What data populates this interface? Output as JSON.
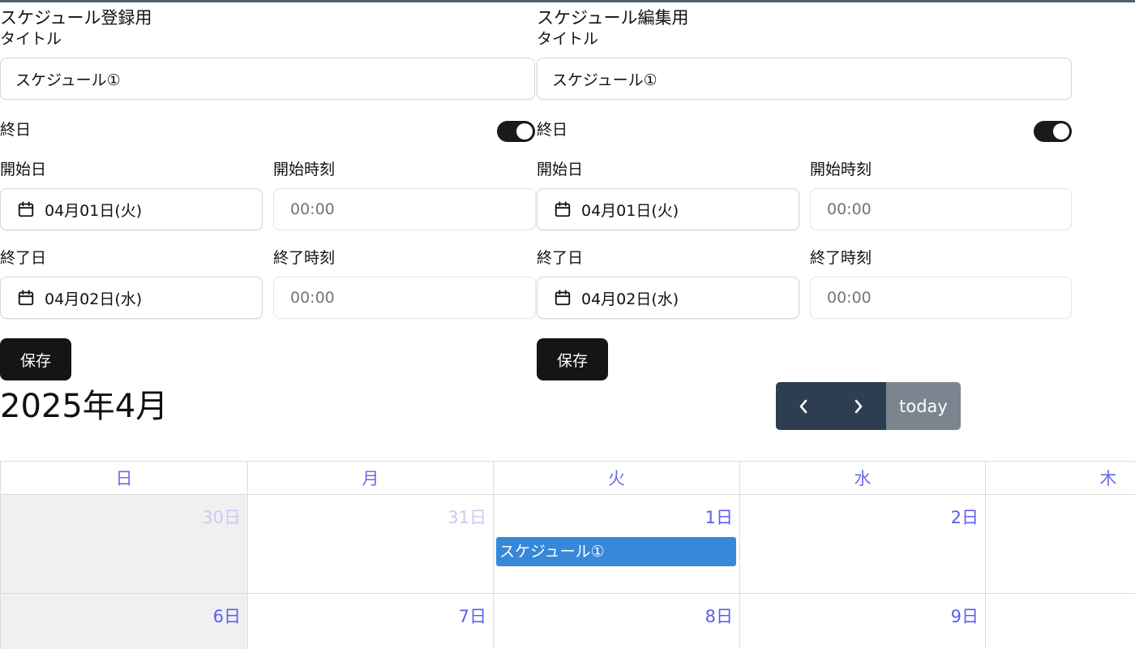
{
  "register_form": {
    "heading": "スケジュール登録用",
    "title_label": "タイトル",
    "title_value": "スケジュール①",
    "allday_label": "終日",
    "start_date_label": "開始日",
    "start_time_label": "開始時刻",
    "start_date": "04月01日(火)",
    "start_time_placeholder": "00:00",
    "end_date_label": "終了日",
    "end_time_label": "終了時刻",
    "end_date": "04月02日(水)",
    "end_time_placeholder": "00:00",
    "save_label": "保存"
  },
  "edit_form": {
    "heading": "スケジュール編集用",
    "title_label": "タイトル",
    "title_value": "スケジュール①",
    "allday_label": "終日",
    "start_date_label": "開始日",
    "start_time_label": "開始時刻",
    "start_date": "04月01日(火)",
    "start_time_placeholder": "00:00",
    "end_date_label": "終了日",
    "end_time_label": "終了時刻",
    "end_date": "04月02日(水)",
    "end_time_placeholder": "00:00",
    "save_label": "保存"
  },
  "calendar": {
    "month_title": "2025年4月",
    "today_label": "today",
    "weekdays": [
      "日",
      "月",
      "火",
      "水",
      "木"
    ],
    "week1": [
      "30日",
      "31日",
      "1日",
      "2日"
    ],
    "week2": [
      "6日",
      "7日",
      "8日",
      "9日"
    ],
    "event_title": "スケジュール①"
  },
  "colors": {
    "event": "#3788d8",
    "nav_button": "#2c3e50",
    "today_button": "#7a8590",
    "day_text": "#5c5cf0"
  }
}
